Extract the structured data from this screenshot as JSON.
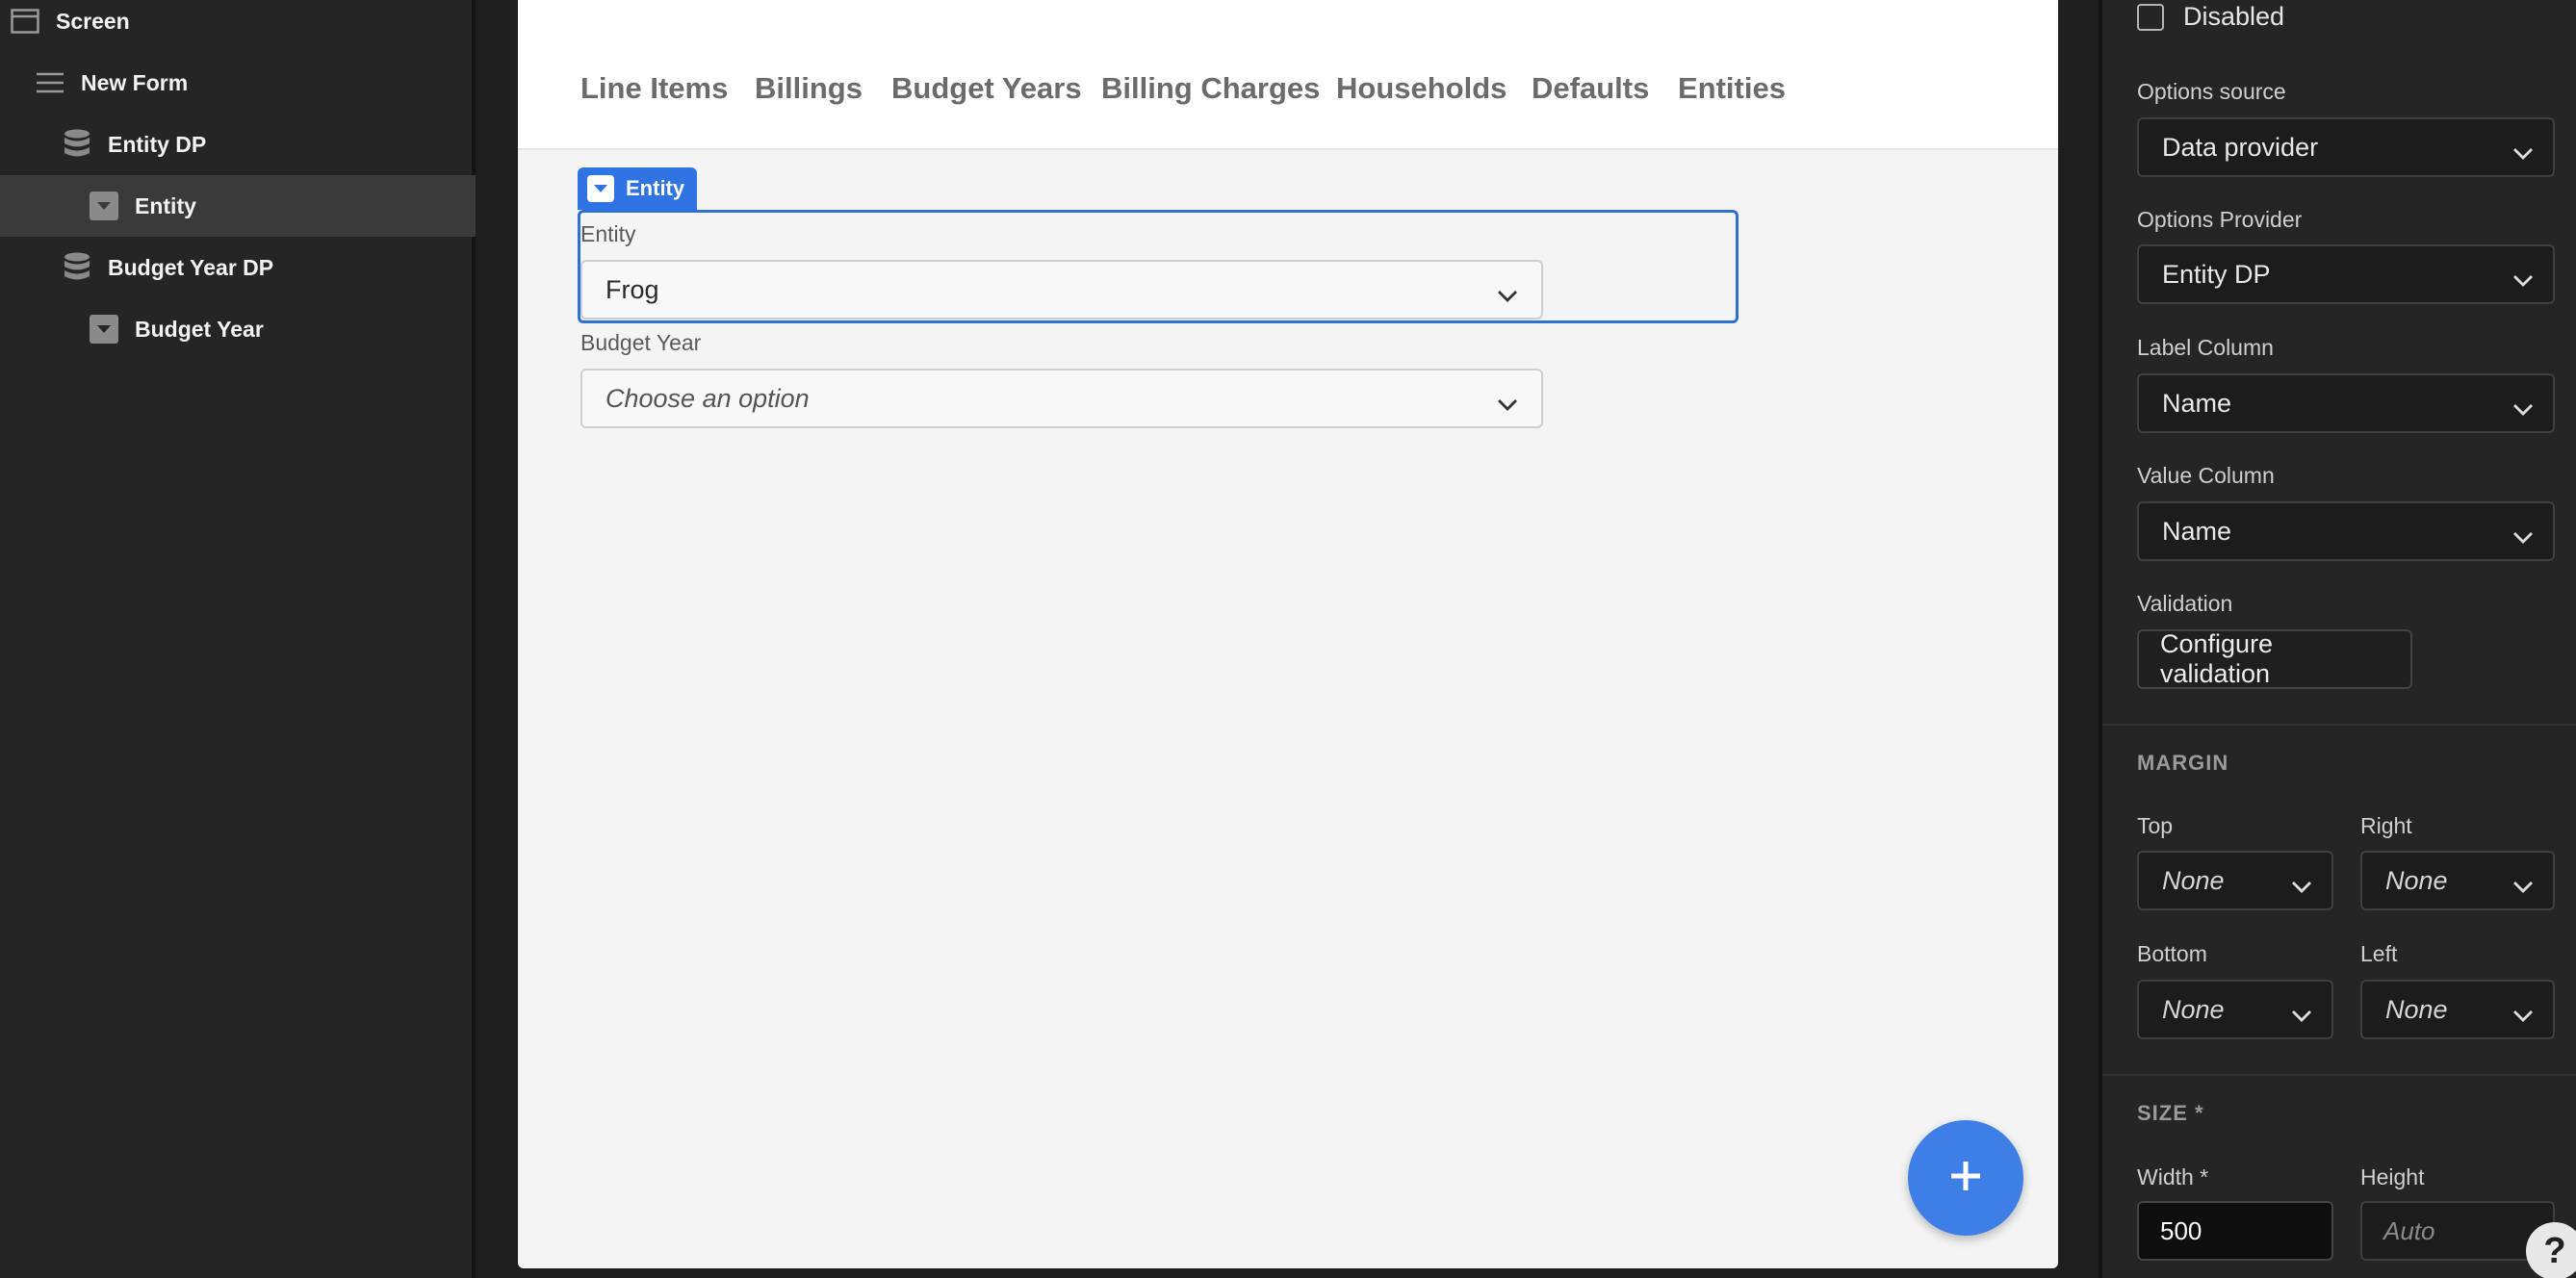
{
  "tree": {
    "screen": "Screen",
    "new_form": "New Form",
    "entity_dp": "Entity DP",
    "entity": "Entity",
    "budget_year_dp": "Budget Year DP",
    "budget_year": "Budget Year"
  },
  "nav": {
    "links": [
      "Line Items",
      "Billings",
      "Budget Years",
      "Billing Charges",
      "Households",
      "Defaults",
      "Entities"
    ]
  },
  "form": {
    "selected_tag": "Entity",
    "entity_label": "Entity",
    "entity_value": "Frog",
    "budget_year_label": "Budget Year",
    "budget_year_placeholder": "Choose an option"
  },
  "settings": {
    "disabled_label": "Disabled",
    "options_source_label": "Options source",
    "options_source_value": "Data provider",
    "options_provider_label": "Options Provider",
    "options_provider_value": "Entity DP",
    "label_column_label": "Label Column",
    "label_column_value": "Name",
    "value_column_label": "Value Column",
    "value_column_value": "Name",
    "validation_label": "Validation",
    "configure_validation": "Configure validation",
    "margin_heading": "MARGIN",
    "top_label": "Top",
    "top_value": "None",
    "right_label": "Right",
    "right_value": "None",
    "bottom_label": "Bottom",
    "bottom_value": "None",
    "left_label": "Left",
    "left_value": "None",
    "size_heading": "SIZE *",
    "width_label": "Width *",
    "width_value": "500",
    "height_label": "Height",
    "height_placeholder": "Auto"
  },
  "help": "?",
  "colors": {
    "accent": "#2f74e2",
    "fab": "#3d7fe6",
    "panel_bg": "#252525",
    "canvas_bg": "#f4f4f4"
  }
}
